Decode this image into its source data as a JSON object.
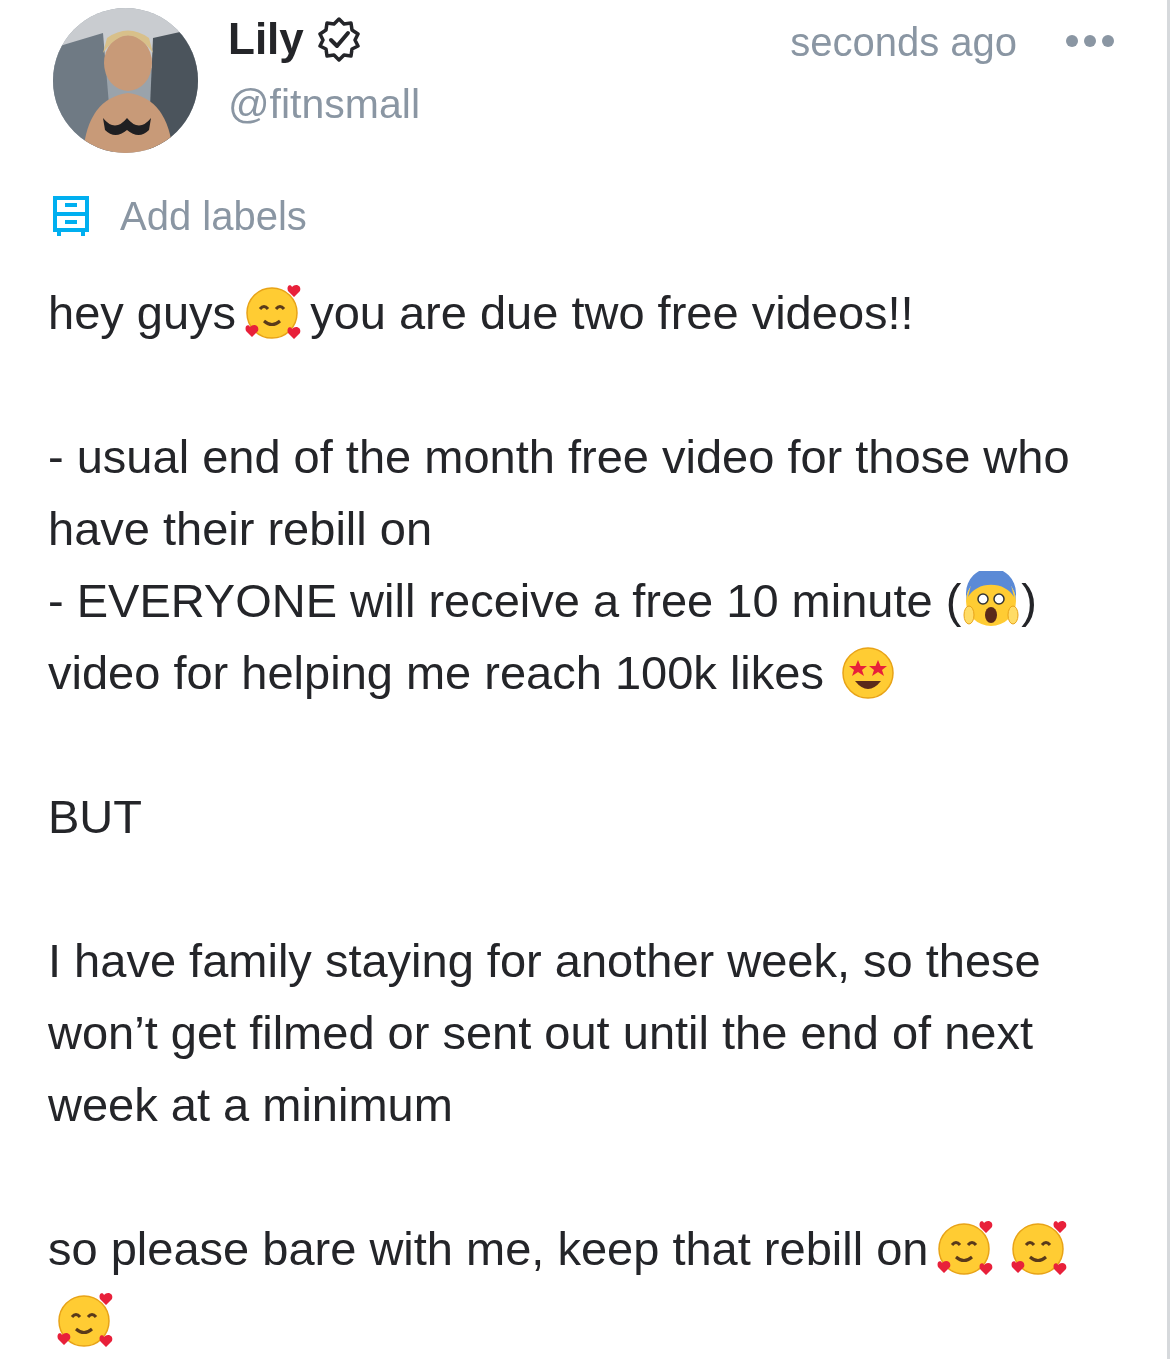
{
  "post": {
    "author": {
      "name": "Lily",
      "verified": true,
      "handle": "@fitnsmall"
    },
    "time": "seconds ago",
    "labels_link": "Add labels",
    "paragraphs": [
      {
        "lines": [
          [
            {
              "kind": "text",
              "text": "hey guys"
            },
            {
              "kind": "hearts-face"
            },
            {
              "kind": "text",
              "text": "you are due two free videos!!"
            }
          ]
        ]
      },
      {
        "lines": [
          [
            {
              "kind": "text",
              "text": "- usual end of the month free video for those who"
            }
          ],
          [
            {
              "kind": "text",
              "text": "have their rebill on"
            }
          ],
          [
            {
              "kind": "text",
              "text": "- EVERYONE will receive a free 10 minute ("
            },
            {
              "kind": "scream-face"
            },
            {
              "kind": "text",
              "text": ")"
            }
          ],
          [
            {
              "kind": "text",
              "text": "video for helping me reach 100k likes"
            },
            {
              "kind": "star-eyes-face"
            }
          ]
        ]
      },
      {
        "lines": [
          [
            {
              "kind": "text",
              "text": "BUT"
            }
          ]
        ]
      },
      {
        "lines": [
          [
            {
              "kind": "text",
              "text": "I have family staying for another week, so these"
            }
          ],
          [
            {
              "kind": "text",
              "text": "won’t get filmed or sent out until the end of next"
            }
          ],
          [
            {
              "kind": "text",
              "text": "week at a minimum"
            }
          ]
        ]
      },
      {
        "lines": [
          [
            {
              "kind": "text",
              "text": "so please bare with me, keep that rebill on"
            },
            {
              "kind": "hearts-face"
            },
            {
              "kind": "hearts-face"
            }
          ],
          [
            {
              "kind": "hearts-face"
            }
          ]
        ]
      }
    ]
  }
}
